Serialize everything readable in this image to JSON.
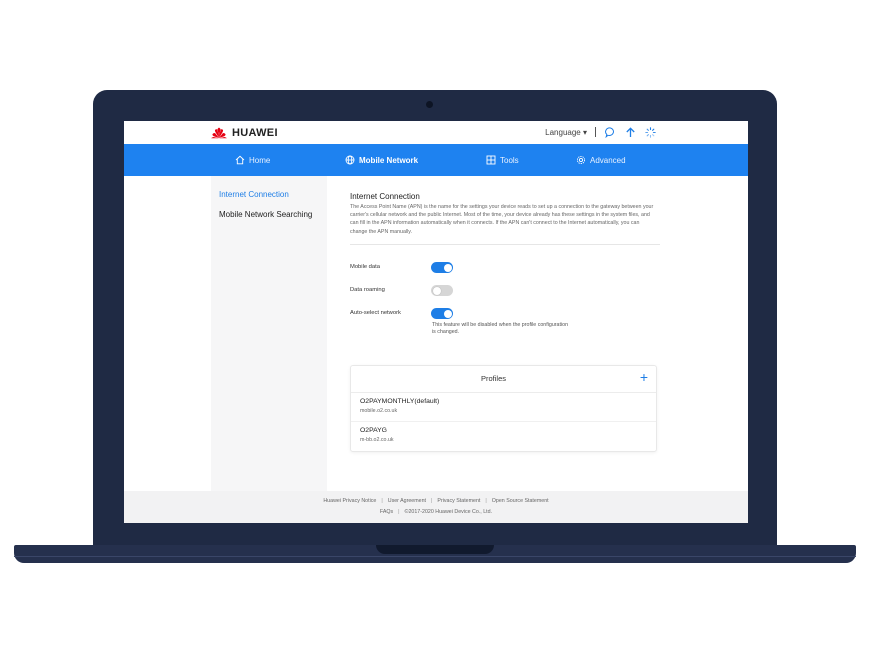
{
  "brand": {
    "name": "HUAWEI",
    "logo_color": "#e60012",
    "accent": "#1e82f0"
  },
  "topbar": {
    "language_label": "Language",
    "icons": [
      "chat-icon",
      "upload-arrow-icon",
      "loading-spinner-icon"
    ]
  },
  "nav": {
    "items": [
      {
        "label": "Home",
        "icon": "home-icon"
      },
      {
        "label": "Mobile Network",
        "icon": "globe-icon",
        "active": true
      },
      {
        "label": "Tools",
        "icon": "tools-icon"
      },
      {
        "label": "Advanced",
        "icon": "gear-icon"
      }
    ]
  },
  "sidebar": {
    "items": [
      {
        "label": "Internet Connection",
        "active": true
      },
      {
        "label": "Mobile Network Searching"
      }
    ]
  },
  "content": {
    "title": "Internet Connection",
    "description": "The Access Point Name (APN) is the name for the settings your device reads to set up a connection to the gateway between your carrier's cellular network and the public Internet. Most of the time, your device already has these settings in the system files, and can fill in the APN information automatically when it connects. If the APN can't connect to the Internet automatically, you can change the APN manually.",
    "settings": [
      {
        "label": "Mobile data",
        "on": true
      },
      {
        "label": "Data roaming",
        "on": false
      },
      {
        "label": "Auto-select network",
        "on": true
      }
    ],
    "auto_select_note": "This feature will be disabled when the profile configuration is changed."
  },
  "profiles": {
    "title": "Profiles",
    "add_symbol": "+",
    "items": [
      {
        "name": "O2PAYMONTHLY(default)",
        "apn": "mobile.o2.co.uk"
      },
      {
        "name": "O2PAYG",
        "apn": "m-bb.o2.co.uk"
      }
    ]
  },
  "footer": {
    "links": [
      "Huawei Privacy Notice",
      "User Agreement",
      "Privacy Statement",
      "Open Source Statement"
    ],
    "faqs": "FAQs",
    "copyright": "©2017-2020 Huawei Device Co., Ltd."
  }
}
